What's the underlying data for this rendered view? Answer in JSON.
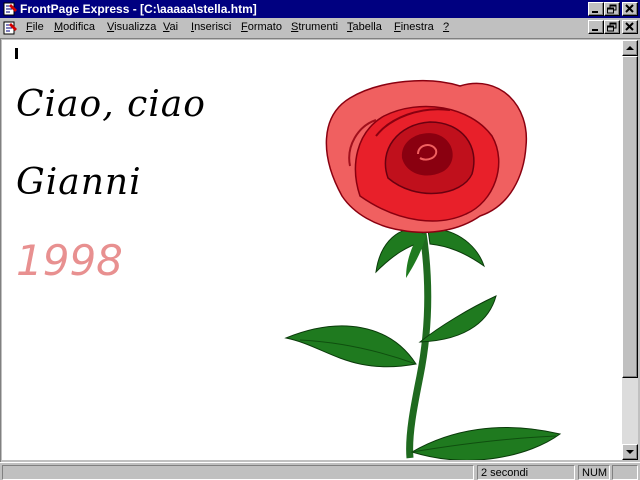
{
  "window": {
    "title": "FrontPage Express - [C:\\aaaaa\\stella.htm]"
  },
  "menu": {
    "items": [
      {
        "label": "File",
        "u": "F",
        "rest": "ile"
      },
      {
        "label": "Modifica",
        "u": "M",
        "rest": "odifica"
      },
      {
        "label": "Visualizza",
        "u": "V",
        "rest": "isualizza"
      },
      {
        "label": "Vai",
        "u": "V",
        "rest": "ai"
      },
      {
        "label": "Inserisci",
        "u": "I",
        "rest": "nserisci"
      },
      {
        "label": "Formato",
        "u": "F",
        "rest": "ormato"
      },
      {
        "label": "Strumenti",
        "u": "S",
        "rest": "trumenti"
      },
      {
        "label": "Tabella",
        "u": "T",
        "rest": "abella"
      },
      {
        "label": "Finestra",
        "u": "F",
        "rest": "inestra"
      },
      {
        "label": "?",
        "u": "?",
        "rest": ""
      }
    ]
  },
  "document": {
    "line1": "Ciao, ciao",
    "line2": "Gianni",
    "year": "1998"
  },
  "status": {
    "panel_main": "",
    "load_time": "2 secondi",
    "panel_empty": "",
    "num": "NUM"
  },
  "colors": {
    "titlebar": "#000080",
    "year_text": "#e89090",
    "rose_red": "#e8202a",
    "rose_dark": "#8a0010",
    "leaf_green": "#1f7a1f"
  },
  "icons": [
    "frontpage-app-icon",
    "document-icon",
    "minimize-icon",
    "restore-icon",
    "close-icon",
    "scroll-up-icon",
    "scroll-down-icon"
  ]
}
